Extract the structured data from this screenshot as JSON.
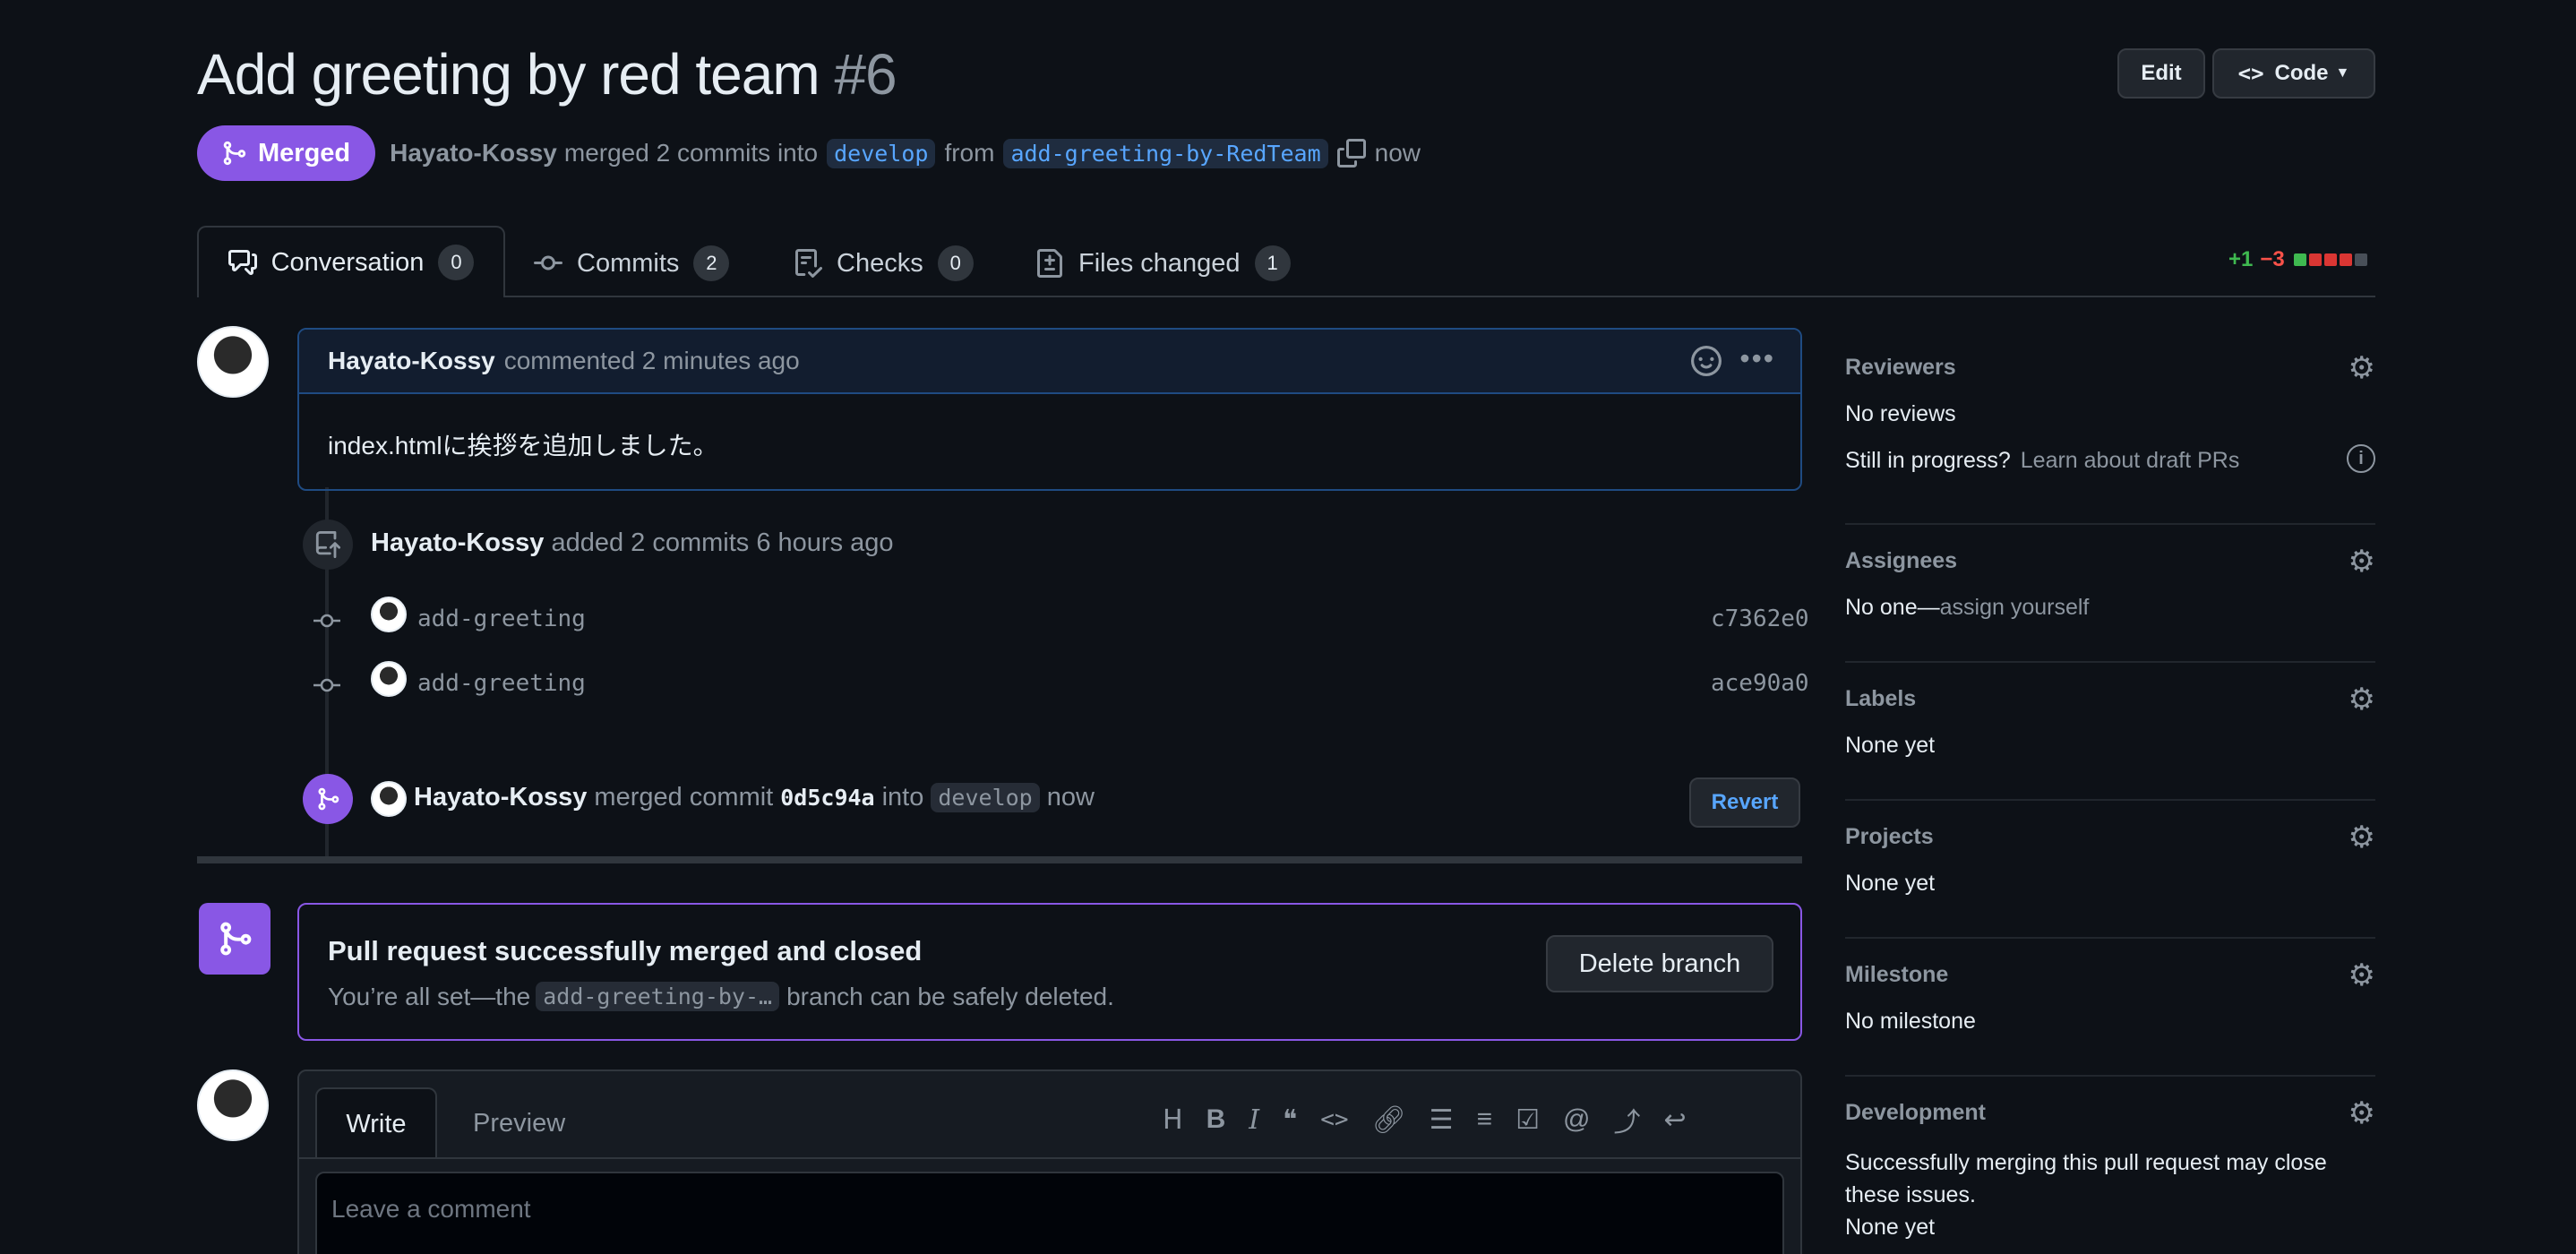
{
  "header": {
    "title": "Add greeting by red team",
    "number": "#6",
    "edit_label": "Edit",
    "code_label": "Code",
    "state_label": "Merged",
    "author": "Hayato-Kossy",
    "merged_text": "merged 2 commits into",
    "base_branch": "develop",
    "from_text": "from",
    "head_branch": "add-greeting-by-RedTeam",
    "time": "now"
  },
  "tabs": [
    {
      "label": "Conversation",
      "count": "0"
    },
    {
      "label": "Commits",
      "count": "2"
    },
    {
      "label": "Checks",
      "count": "0"
    },
    {
      "label": "Files changed",
      "count": "1"
    }
  ],
  "diffstat": {
    "added": "+1",
    "removed": "−3"
  },
  "comment": {
    "author": "Hayato-Kossy",
    "meta": "commented 2 minutes ago",
    "body": "index.htmlに挨拶を追加しました。"
  },
  "commits_event": {
    "author": "Hayato-Kossy",
    "text": "added 2 commits 6 hours ago",
    "commits": [
      {
        "message": "add-greeting",
        "sha": "c7362e0"
      },
      {
        "message": "add-greeting",
        "sha": "ace90a0"
      }
    ]
  },
  "merge_event": {
    "author": "Hayato-Kossy",
    "text1": "merged commit",
    "sha": "0d5c94a",
    "text2": "into",
    "branch": "develop",
    "time": "now",
    "revert_label": "Revert"
  },
  "merged_box": {
    "title": "Pull request successfully merged and closed",
    "text1": "You’re all set—the",
    "branch": "add-greeting-by-…",
    "text2": "branch can be safely deleted.",
    "delete_label": "Delete branch"
  },
  "editor": {
    "write_tab": "Write",
    "preview_tab": "Preview",
    "placeholder": "Leave a comment"
  },
  "sidebar": {
    "reviewers": {
      "heading": "Reviewers",
      "value": "No reviews",
      "progress_text": "Still in progress?",
      "progress_link": "Learn about draft PRs"
    },
    "assignees": {
      "heading": "Assignees",
      "value": "No one—",
      "link": "assign yourself"
    },
    "labels": {
      "heading": "Labels",
      "value": "None yet"
    },
    "projects": {
      "heading": "Projects",
      "value": "None yet"
    },
    "milestone": {
      "heading": "Milestone",
      "value": "No milestone"
    },
    "development": {
      "heading": "Development",
      "value": "Successfully merging this pull request may close these issues.",
      "value2": "None yet"
    }
  },
  "colors": {
    "merged": "#8957e5",
    "link": "#58a6ff",
    "added": "#3fb950",
    "removed": "#f85149"
  }
}
